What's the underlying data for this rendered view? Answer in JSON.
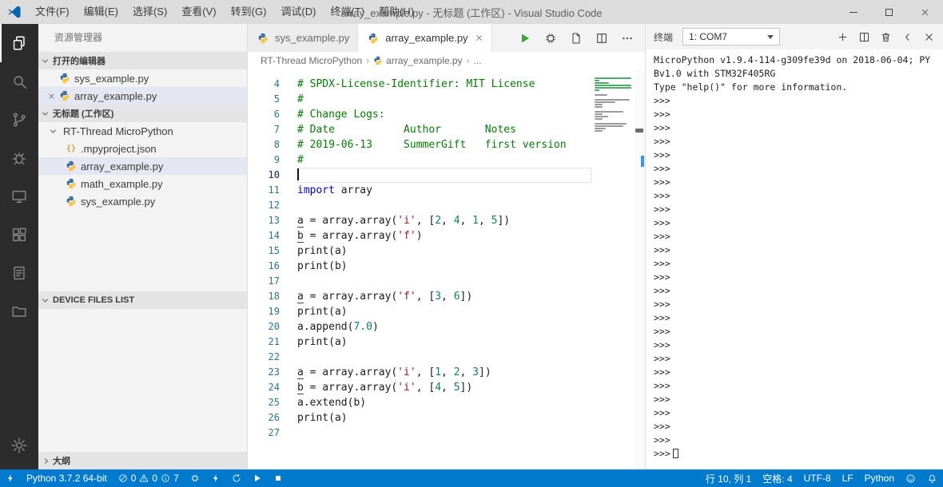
{
  "window": {
    "title": "array_example.py - 无标题 (工作区) - Visual Studio Code",
    "menus": [
      "文件(F)",
      "编辑(E)",
      "选择(S)",
      "查看(V)",
      "转到(G)",
      "调试(D)",
      "终端(T)",
      "帮助(H)"
    ]
  },
  "activity_bar": {
    "items": [
      {
        "id": "explorer",
        "icon": "files-icon",
        "active": true
      },
      {
        "id": "search",
        "icon": "search-icon",
        "active": false
      },
      {
        "id": "source-control",
        "icon": "branch-icon",
        "active": false
      },
      {
        "id": "run-debug",
        "icon": "bug-icon",
        "active": false
      },
      {
        "id": "device",
        "icon": "monitor-icon",
        "active": false
      },
      {
        "id": "extensions",
        "icon": "extensions-icon",
        "active": false
      },
      {
        "id": "notes",
        "icon": "clipboard-icon",
        "active": false
      },
      {
        "id": "project",
        "icon": "folder-icon",
        "active": false
      }
    ]
  },
  "sidebar": {
    "title": "资源管理器",
    "open_editors": {
      "header": "打开的编辑器",
      "items": [
        {
          "label": "sys_example.py",
          "icon": "python-icon",
          "selected": false,
          "show_close": false
        },
        {
          "label": "array_example.py",
          "icon": "python-icon",
          "selected": true,
          "show_close": true
        }
      ]
    },
    "workspace": {
      "header": "无标题 (工作区)",
      "folder": {
        "label": "RT-Thread MicroPython"
      },
      "files": [
        {
          "label": ".mpyproject.json",
          "icon": "json-icon",
          "selected": false
        },
        {
          "label": "array_example.py",
          "icon": "python-icon",
          "selected": true
        },
        {
          "label": "math_example.py",
          "icon": "python-icon",
          "selected": false
        },
        {
          "label": "sys_example.py",
          "icon": "python-icon",
          "selected": false
        }
      ]
    },
    "device_files_header": "DEVICE FILES LIST",
    "outline_header": "大纲"
  },
  "editor": {
    "tabs": [
      {
        "label": "sys_example.py",
        "icon": "python-icon",
        "active": false,
        "show_close": false
      },
      {
        "label": "array_example.py",
        "icon": "python-icon",
        "active": true,
        "show_close": true
      }
    ],
    "actions": [
      {
        "id": "run",
        "icon": "play-icon",
        "run": true
      },
      {
        "id": "build",
        "icon": "chip-icon",
        "run": false
      },
      {
        "id": "preview",
        "icon": "file-icon",
        "run": false
      },
      {
        "id": "split-editor",
        "icon": "split-icon",
        "run": false
      },
      {
        "id": "more-actions",
        "icon": "ellipsis-icon",
        "run": false
      }
    ],
    "breadcrumb": {
      "items": [
        "RT-Thread MicroPython",
        "array_example.py",
        "..."
      ]
    },
    "current_line": 10,
    "lines": [
      {
        "n": 4,
        "s": [
          {
            "t": "# SPDX-License-Identifier: MIT License",
            "c": "cm"
          }
        ]
      },
      {
        "n": 5,
        "s": [
          {
            "t": "#",
            "c": "cm"
          }
        ]
      },
      {
        "n": 6,
        "s": [
          {
            "t": "# Change Logs:",
            "c": "cm"
          }
        ]
      },
      {
        "n": 7,
        "s": [
          {
            "t": "# Date           Author       Notes",
            "c": "cm"
          }
        ]
      },
      {
        "n": 8,
        "s": [
          {
            "t": "# 2019-06-13     SummerGift   first version",
            "c": "cm"
          }
        ]
      },
      {
        "n": 9,
        "s": [
          {
            "t": "#",
            "c": "cm"
          }
        ]
      },
      {
        "n": 10,
        "s": []
      },
      {
        "n": 11,
        "s": [
          {
            "t": "import",
            "c": "kw"
          },
          {
            "t": " array",
            "c": "pl"
          }
        ]
      },
      {
        "n": 12,
        "s": []
      },
      {
        "n": 13,
        "s": [
          {
            "t": "a",
            "c": "pl",
            "u": true
          },
          {
            "t": " = array.array(",
            "c": "pl"
          },
          {
            "t": "'i'",
            "c": "st"
          },
          {
            "t": ", [",
            "c": "pl"
          },
          {
            "t": "2",
            "c": "nb"
          },
          {
            "t": ", ",
            "c": "pl"
          },
          {
            "t": "4",
            "c": "nb"
          },
          {
            "t": ", ",
            "c": "pl"
          },
          {
            "t": "1",
            "c": "nb"
          },
          {
            "t": ", ",
            "c": "pl"
          },
          {
            "t": "5",
            "c": "nb"
          },
          {
            "t": "])",
            "c": "pl"
          }
        ]
      },
      {
        "n": 14,
        "s": [
          {
            "t": "b",
            "c": "pl",
            "u": true
          },
          {
            "t": " = array.array(",
            "c": "pl"
          },
          {
            "t": "'f'",
            "c": "st"
          },
          {
            "t": ")",
            "c": "pl"
          }
        ]
      },
      {
        "n": 15,
        "s": [
          {
            "t": "print(a)",
            "c": "pl"
          }
        ]
      },
      {
        "n": 16,
        "s": [
          {
            "t": "print(b)",
            "c": "pl"
          }
        ]
      },
      {
        "n": 17,
        "s": []
      },
      {
        "n": 18,
        "s": [
          {
            "t": "a",
            "c": "pl",
            "u": true
          },
          {
            "t": " = array.array(",
            "c": "pl"
          },
          {
            "t": "'f'",
            "c": "st"
          },
          {
            "t": ", [",
            "c": "pl"
          },
          {
            "t": "3",
            "c": "nb"
          },
          {
            "t": ", ",
            "c": "pl"
          },
          {
            "t": "6",
            "c": "nb"
          },
          {
            "t": "])",
            "c": "pl"
          }
        ]
      },
      {
        "n": 19,
        "s": [
          {
            "t": "print(a)",
            "c": "pl"
          }
        ]
      },
      {
        "n": 20,
        "s": [
          {
            "t": "a.append(",
            "c": "pl"
          },
          {
            "t": "7.0",
            "c": "nb"
          },
          {
            "t": ")",
            "c": "pl"
          }
        ]
      },
      {
        "n": 21,
        "s": [
          {
            "t": "print(a)",
            "c": "pl"
          }
        ]
      },
      {
        "n": 22,
        "s": []
      },
      {
        "n": 23,
        "s": [
          {
            "t": "a",
            "c": "pl",
            "u": true
          },
          {
            "t": " = array.array(",
            "c": "pl"
          },
          {
            "t": "'i'",
            "c": "st"
          },
          {
            "t": ", [",
            "c": "pl"
          },
          {
            "t": "1",
            "c": "nb"
          },
          {
            "t": ", ",
            "c": "pl"
          },
          {
            "t": "2",
            "c": "nb"
          },
          {
            "t": ", ",
            "c": "pl"
          },
          {
            "t": "3",
            "c": "nb"
          },
          {
            "t": "])",
            "c": "pl"
          }
        ]
      },
      {
        "n": 24,
        "s": [
          {
            "t": "b",
            "c": "pl",
            "u": true
          },
          {
            "t": " = array.array(",
            "c": "pl"
          },
          {
            "t": "'i'",
            "c": "st"
          },
          {
            "t": ", [",
            "c": "pl"
          },
          {
            "t": "4",
            "c": "nb"
          },
          {
            "t": ", ",
            "c": "pl"
          },
          {
            "t": "5",
            "c": "nb"
          },
          {
            "t": "])",
            "c": "pl"
          }
        ]
      },
      {
        "n": 25,
        "s": [
          {
            "t": "a.extend(b)",
            "c": "pl"
          }
        ]
      },
      {
        "n": 26,
        "s": [
          {
            "t": "print(a)",
            "c": "pl"
          }
        ]
      },
      {
        "n": 27,
        "s": []
      }
    ]
  },
  "terminal": {
    "title": "终端",
    "dropdown_value": "1: COM7",
    "banner": [
      "MicroPython v1.9.4-114-g309fe39d on 2018-06-04; PY",
      "Bv1.0 with STM32F405RG",
      "Type \"help()\" for more information."
    ],
    "prompt": ">>>",
    "prompt_repeat": 26,
    "actions": [
      {
        "id": "new-terminal",
        "icon": "plus-icon"
      },
      {
        "id": "split-terminal",
        "icon": "split-icon"
      },
      {
        "id": "kill-terminal",
        "icon": "trash-icon"
      },
      {
        "id": "collapse-panel",
        "icon": "chevron-left-icon"
      },
      {
        "id": "close-panel",
        "icon": "close-icon"
      }
    ]
  },
  "status_bar": {
    "python_version": "Python 3.7.2 64-bit",
    "problems": {
      "errors": "0",
      "warnings": "0",
      "infos": "7"
    },
    "device_actions": [
      {
        "id": "board",
        "icon": "chip-icon"
      },
      {
        "id": "flash",
        "icon": "lightning-icon"
      },
      {
        "id": "sync",
        "icon": "sync-icon"
      },
      {
        "id": "run-device",
        "icon": "play-icon"
      },
      {
        "id": "stop-device",
        "icon": "stop-icon"
      }
    ],
    "cursor_position": "行 10, 列 1",
    "indentation": "空格: 4",
    "encoding": "UTF-8",
    "eol": "LF",
    "language": "Python"
  }
}
